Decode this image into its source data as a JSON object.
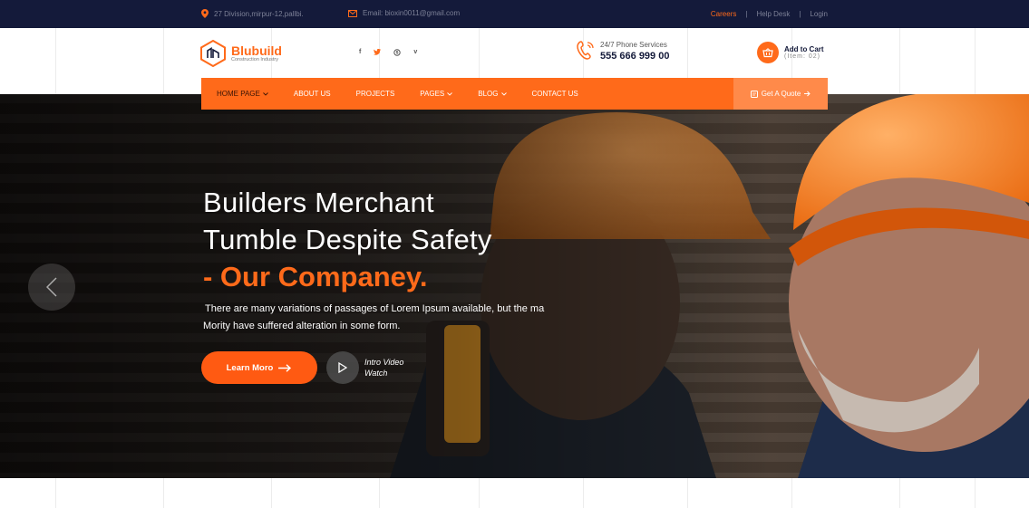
{
  "colors": {
    "accent": "#ff6a1a",
    "topbar": "#141a3a"
  },
  "topbar": {
    "address": "27 Division,mirpur-12,pallbi.",
    "email": "Email: bioxin0011@gmail.com",
    "links": [
      "Careers",
      "Help Desk",
      "Login"
    ],
    "separator": "|"
  },
  "header": {
    "logo_name": "Blubuild",
    "logo_tagline": "Construction Industry",
    "social": [
      {
        "icon": "facebook-icon",
        "glyph": "f"
      },
      {
        "icon": "twitter-icon",
        "glyph": "♥"
      },
      {
        "icon": "skype-icon",
        "glyph": "s"
      },
      {
        "icon": "vimeo-icon",
        "glyph": "v"
      }
    ],
    "phone_label": "24/7 Phone Services",
    "phone_number": "555 666 999 00",
    "cart_title": "Add to Cart",
    "cart_items": "(Item: 02)"
  },
  "nav": {
    "items": [
      {
        "label": "HOME PAGE",
        "dropdown": true
      },
      {
        "label": "ABOUT US",
        "dropdown": false
      },
      {
        "label": "PROJECTS",
        "dropdown": false
      },
      {
        "label": "PAGES",
        "dropdown": true
      },
      {
        "label": "BLOG",
        "dropdown": true
      },
      {
        "label": "CONTACT US",
        "dropdown": false
      }
    ],
    "quote": "Get A Quote"
  },
  "hero": {
    "line1": "Builders Merchant",
    "line2": "Tumble Despite Safety",
    "line3": "- Our Companey.",
    "desc1": "There are many variations of passages of Lorem Ipsum available, but the ma",
    "desc2": "Mority have suffered alteration in some form.",
    "button": "Learn Moro",
    "video1": "Intro Video",
    "video2": "Watch"
  }
}
